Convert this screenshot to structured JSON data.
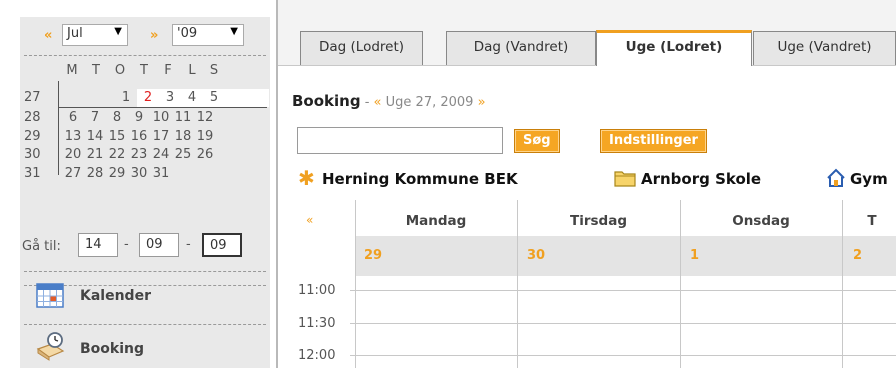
{
  "mini_calendar": {
    "prev_arrow": "«",
    "next_arrow": "»",
    "month": "Jul",
    "year": "'09",
    "weekday_headers": [
      "M",
      "T",
      "O",
      "T",
      "F",
      "L",
      "S"
    ],
    "weeks": [
      {
        "num": "27",
        "days": [
          "",
          "",
          "1",
          "2",
          "3",
          "4",
          "5"
        ]
      },
      {
        "num": "28",
        "days": [
          "6",
          "7",
          "8",
          "9",
          "10",
          "11",
          "12"
        ]
      },
      {
        "num": "29",
        "days": [
          "13",
          "14",
          "15",
          "16",
          "17",
          "18",
          "19"
        ]
      },
      {
        "num": "30",
        "days": [
          "20",
          "21",
          "22",
          "23",
          "24",
          "25",
          "26"
        ]
      },
      {
        "num": "31",
        "days": [
          "27",
          "28",
          "29",
          "30",
          "31",
          "",
          ""
        ]
      }
    ],
    "highlight_day": "2",
    "goto_label": "Gå til:",
    "goto_day": "14",
    "goto_month": "09",
    "goto_year": "09",
    "goto_sep": "-"
  },
  "menu": {
    "items": [
      {
        "label": "Kalender",
        "icon": "calendar-icon"
      },
      {
        "label": "Booking",
        "icon": "booking-icon"
      }
    ]
  },
  "tabs": [
    {
      "label": "Dag (Lodret)",
      "active": false
    },
    {
      "label": "Dag (Vandret)",
      "active": false
    },
    {
      "label": "Uge (Lodret)",
      "active": true
    },
    {
      "label": "Uge (Vandret)",
      "active": false
    }
  ],
  "header": {
    "title": "Booking",
    "separator": " - ",
    "prev": "«",
    "week_text": " Uge 27, 2009 ",
    "next": "»"
  },
  "search": {
    "value": "",
    "button": "Søg",
    "settings_button": "Indstillinger"
  },
  "locations": [
    {
      "label": "Herning Kommune BEK",
      "icon": "asterisk-icon"
    },
    {
      "label": "Arnborg Skole",
      "icon": "folder-icon"
    },
    {
      "label": "Gym",
      "icon": "home-icon"
    }
  ],
  "grid": {
    "prev": "«",
    "days": [
      "Mandag",
      "Tirsdag",
      "Onsdag",
      "T"
    ],
    "dates": [
      "29",
      "30",
      "1",
      "2"
    ],
    "times": [
      "11:00",
      "11:30",
      "12:00"
    ]
  },
  "colors": {
    "accent": "#f0a020",
    "highlight_day": "#e02020",
    "sidebar_bg": "#e9e9e9",
    "date_row_bg": "#e4e4e4"
  }
}
